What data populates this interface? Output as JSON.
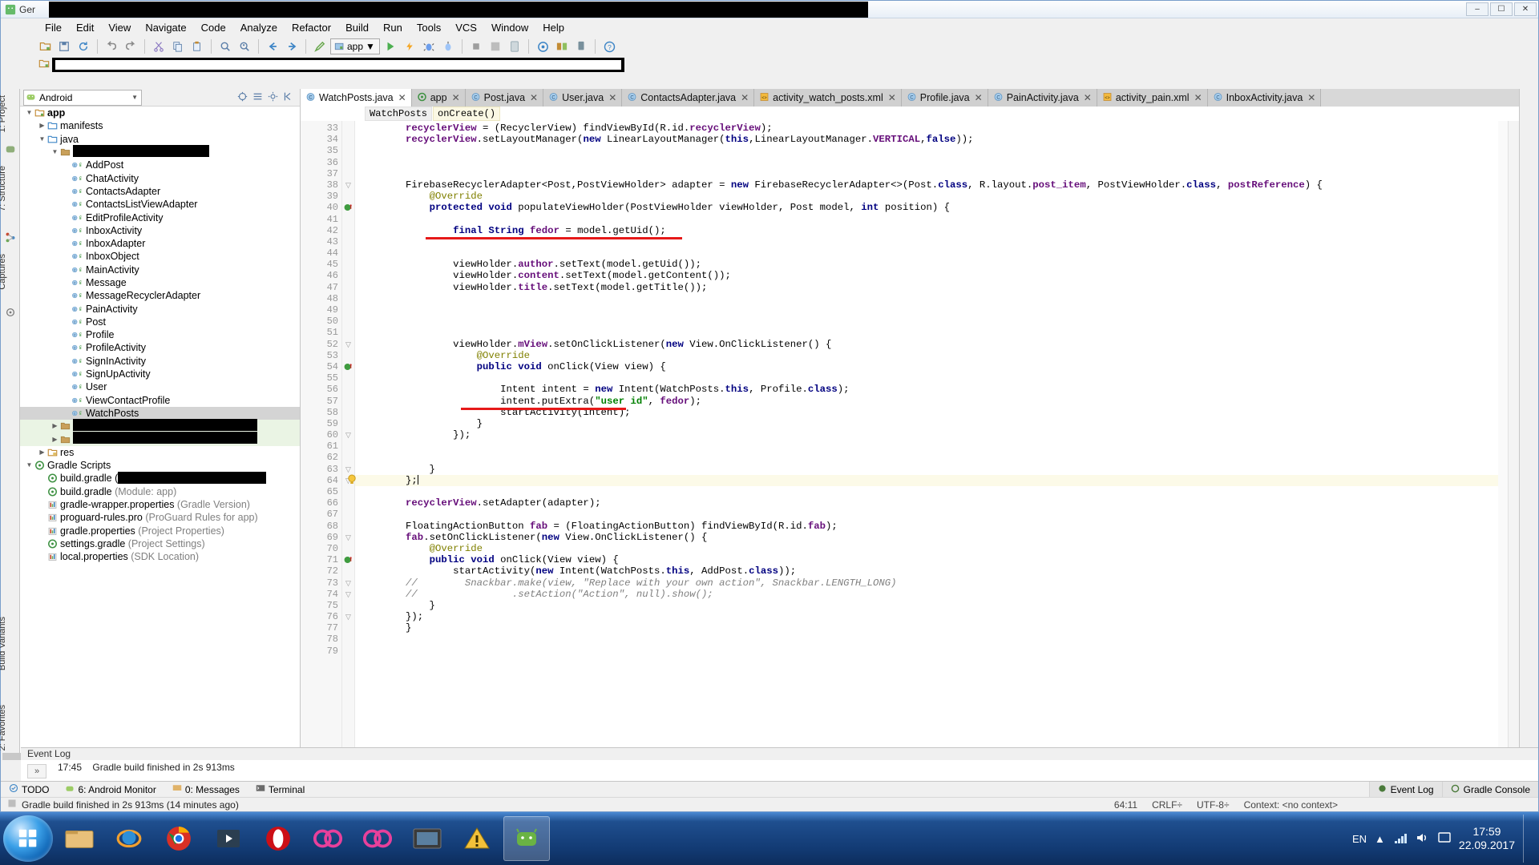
{
  "window": {
    "title": "Ger",
    "minimize": "–",
    "maximize": "☐",
    "close": "✕",
    "redacted": ""
  },
  "menubar": [
    {
      "label": "File"
    },
    {
      "label": "Edit"
    },
    {
      "label": "View"
    },
    {
      "label": "Navigate"
    },
    {
      "label": "Code"
    },
    {
      "label": "Analyze"
    },
    {
      "label": "Refactor"
    },
    {
      "label": "Build"
    },
    {
      "label": "Run"
    },
    {
      "label": "Tools"
    },
    {
      "label": "VCS"
    },
    {
      "label": "Window"
    },
    {
      "label": "Help"
    }
  ],
  "toolbar": {
    "run_config": "app",
    "icons": [
      "open-folder-icon",
      "save-all-icon",
      "sync-icon",
      "undo-icon",
      "redo-icon",
      "cut-icon",
      "copy-icon",
      "paste-icon",
      "find-icon",
      "find-usages-icon",
      "back-icon",
      "forward-icon",
      "build-icon"
    ],
    "right_icons": [
      "run-icon",
      "debug-icon",
      "instant-run-icon",
      "avd-manager-icon",
      "sdk-manager-icon",
      "stop-icon",
      "sync-gradle-icon",
      "project-structure-icon",
      "settings-icon",
      "android-device-monitor-icon",
      "help-icon"
    ]
  },
  "project_panel": {
    "scope": "Android",
    "header_icons": [
      "collapse-all-icon",
      "target-icon",
      "settings-icon",
      "hide-icon"
    ],
    "tree": [
      {
        "indent": 0,
        "arrow": "open",
        "icon": "module-icon",
        "label": "app",
        "bold": true
      },
      {
        "indent": 1,
        "arrow": "closed",
        "icon": "folder-icon",
        "label": "manifests"
      },
      {
        "indent": 1,
        "arrow": "open",
        "icon": "folder-icon",
        "label": "java"
      },
      {
        "indent": 2,
        "arrow": "open",
        "icon": "package-icon",
        "label": "",
        "redacted": true,
        "redact_width": 170
      },
      {
        "indent": 3,
        "arrow": "none",
        "icon": "class-icon",
        "label": "AddPost"
      },
      {
        "indent": 3,
        "arrow": "none",
        "icon": "class-icon",
        "label": "ChatActivity"
      },
      {
        "indent": 3,
        "arrow": "none",
        "icon": "class-icon",
        "label": "ContactsAdapter"
      },
      {
        "indent": 3,
        "arrow": "none",
        "icon": "class-icon",
        "label": "ContactsListViewAdapter"
      },
      {
        "indent": 3,
        "arrow": "none",
        "icon": "class-icon",
        "label": "EditProfileActivity"
      },
      {
        "indent": 3,
        "arrow": "none",
        "icon": "class-icon",
        "label": "InboxActivity"
      },
      {
        "indent": 3,
        "arrow": "none",
        "icon": "class-icon",
        "label": "InboxAdapter"
      },
      {
        "indent": 3,
        "arrow": "none",
        "icon": "class-icon",
        "label": "InboxObject"
      },
      {
        "indent": 3,
        "arrow": "none",
        "icon": "class-icon",
        "label": "MainActivity"
      },
      {
        "indent": 3,
        "arrow": "none",
        "icon": "class-icon",
        "label": "Message"
      },
      {
        "indent": 3,
        "arrow": "none",
        "icon": "class-icon",
        "label": "MessageRecyclerAdapter"
      },
      {
        "indent": 3,
        "arrow": "none",
        "icon": "class-icon",
        "label": "PainActivity"
      },
      {
        "indent": 3,
        "arrow": "none",
        "icon": "class-icon",
        "label": "Post"
      },
      {
        "indent": 3,
        "arrow": "none",
        "icon": "class-icon",
        "label": "Profile"
      },
      {
        "indent": 3,
        "arrow": "none",
        "icon": "class-icon",
        "label": "ProfileActivity"
      },
      {
        "indent": 3,
        "arrow": "none",
        "icon": "class-icon",
        "label": "SignInActivity"
      },
      {
        "indent": 3,
        "arrow": "none",
        "icon": "class-icon",
        "label": "SignUpActivity"
      },
      {
        "indent": 3,
        "arrow": "none",
        "icon": "class-icon",
        "label": "User"
      },
      {
        "indent": 3,
        "arrow": "none",
        "icon": "class-icon",
        "label": "ViewContactProfile"
      },
      {
        "indent": 3,
        "arrow": "none",
        "icon": "class-icon",
        "label": "WatchPosts",
        "selected": true
      },
      {
        "indent": 2,
        "arrow": "closed",
        "icon": "package-icon",
        "label": "",
        "redacted": true,
        "redact_width": 230,
        "green": true
      },
      {
        "indent": 2,
        "arrow": "closed",
        "icon": "package-icon",
        "label": "",
        "redacted": true,
        "redact_width": 230,
        "green": true
      },
      {
        "indent": 1,
        "arrow": "closed",
        "icon": "res-icon",
        "label": "res"
      },
      {
        "indent": 0,
        "arrow": "open",
        "icon": "gradle-icon",
        "label": "Gradle Scripts"
      },
      {
        "indent": 1,
        "arrow": "none",
        "icon": "gradle-file-icon",
        "label": "build.gradle (",
        "redacted_tail": true,
        "redact_width": 185
      },
      {
        "indent": 1,
        "arrow": "none",
        "icon": "gradle-file-icon",
        "label": "build.gradle ",
        "dim": "(Module: app)"
      },
      {
        "indent": 1,
        "arrow": "none",
        "icon": "properties-icon",
        "label": "gradle-wrapper.properties ",
        "dim": "(Gradle Version)"
      },
      {
        "indent": 1,
        "arrow": "none",
        "icon": "properties-icon",
        "label": "proguard-rules.pro ",
        "dim": "(ProGuard Rules for app)"
      },
      {
        "indent": 1,
        "arrow": "none",
        "icon": "properties-icon",
        "label": "gradle.properties ",
        "dim": "(Project Properties)"
      },
      {
        "indent": 1,
        "arrow": "none",
        "icon": "gradle-file-icon",
        "label": "settings.gradle ",
        "dim": "(Project Settings)"
      },
      {
        "indent": 1,
        "arrow": "none",
        "icon": "properties-icon",
        "label": "local.properties ",
        "dim": "(SDK Location)"
      }
    ]
  },
  "left_tool_tabs": [
    "1: Project",
    "7: Structure",
    "Captures"
  ],
  "left_bottom_tabs": [
    "Build Variants",
    "2: Favorites"
  ],
  "editor": {
    "tabs": [
      {
        "label": "WatchPosts.java",
        "icon": "java-class-icon",
        "active": true
      },
      {
        "label": "app",
        "icon": "gradle-icon",
        "active": false
      },
      {
        "label": "Post.java",
        "icon": "java-class-icon",
        "active": false
      },
      {
        "label": "User.java",
        "icon": "java-class-icon",
        "active": false
      },
      {
        "label": "ContactsAdapter.java",
        "icon": "java-class-icon",
        "active": false
      },
      {
        "label": "activity_watch_posts.xml",
        "icon": "xml-layout-icon",
        "active": false
      },
      {
        "label": "Profile.java",
        "icon": "java-class-icon",
        "active": false
      },
      {
        "label": "PainActivity.java",
        "icon": "java-class-icon",
        "active": false
      },
      {
        "label": "activity_pain.xml",
        "icon": "xml-layout-icon",
        "active": false
      },
      {
        "label": "InboxActivity.java",
        "icon": "java-class-icon",
        "active": false
      }
    ],
    "breadcrumbs": [
      "WatchPosts",
      "onCreate()"
    ],
    "first_line_number": 33,
    "lines": [
      {
        "n": 33,
        "indent": 4,
        "html": "recyclerView = (RecyclerView) findViewById(R.id.<span class=\"fld\">recyclerView</span>);",
        "plain": "recyclerView = (RecyclerView) findViewById(R.id.recyclerView);"
      },
      {
        "n": 34,
        "plain": "recyclerView.setLayoutManager(new LinearLayoutManager(this,LinearLayoutManager.VERTICAL,false));"
      },
      {
        "n": 35,
        "plain": ""
      },
      {
        "n": 36,
        "plain": ""
      },
      {
        "n": 37,
        "plain": ""
      },
      {
        "n": 38,
        "plain": "FirebaseRecyclerAdapter<Post,PostViewHolder> adapter = new FirebaseRecyclerAdapter<>(Post.class, R.layout.post_item, PostViewHolder.class, postReference) {"
      },
      {
        "n": 39,
        "plain": "    @Override"
      },
      {
        "n": 40,
        "plain": "    protected void populateViewHolder(PostViewHolder viewHolder, Post model, int position) {"
      },
      {
        "n": 41,
        "plain": ""
      },
      {
        "n": 42,
        "plain": "        final String fedor = model.getUid();"
      },
      {
        "n": 43,
        "plain": ""
      },
      {
        "n": 44,
        "plain": ""
      },
      {
        "n": 45,
        "plain": "        viewHolder.author.setText(model.getUid());"
      },
      {
        "n": 46,
        "plain": "        viewHolder.content.setText(model.getContent());"
      },
      {
        "n": 47,
        "plain": "        viewHolder.title.setText(model.getTitle());"
      },
      {
        "n": 48,
        "plain": ""
      },
      {
        "n": 49,
        "plain": ""
      },
      {
        "n": 50,
        "plain": ""
      },
      {
        "n": 51,
        "plain": ""
      },
      {
        "n": 52,
        "plain": "        viewHolder.mView.setOnClickListener(new View.OnClickListener() {"
      },
      {
        "n": 53,
        "plain": "            @Override"
      },
      {
        "n": 54,
        "plain": "            public void onClick(View view) {"
      },
      {
        "n": 55,
        "plain": ""
      },
      {
        "n": 56,
        "plain": "                Intent intent = new Intent(WatchPosts.this, Profile.class);"
      },
      {
        "n": 57,
        "plain": "                intent.putExtra(\"user id\", fedor);"
      },
      {
        "n": 58,
        "plain": "                startActivity(intent);"
      },
      {
        "n": 59,
        "plain": "            }"
      },
      {
        "n": 60,
        "plain": "        });"
      },
      {
        "n": 61,
        "plain": ""
      },
      {
        "n": 62,
        "plain": ""
      },
      {
        "n": 63,
        "plain": "    }"
      },
      {
        "n": 64,
        "plain": "};",
        "highlight": true
      },
      {
        "n": 65,
        "plain": ""
      },
      {
        "n": 66,
        "plain": "recyclerView.setAdapter(adapter);"
      },
      {
        "n": 67,
        "plain": ""
      },
      {
        "n": 68,
        "plain": "FloatingActionButton fab = (FloatingActionButton) findViewById(R.id.fab);"
      },
      {
        "n": 69,
        "plain": "fab.setOnClickListener(new View.OnClickListener() {"
      },
      {
        "n": 70,
        "plain": "    @Override"
      },
      {
        "n": 71,
        "plain": "    public void onClick(View view) {"
      },
      {
        "n": 72,
        "plain": "        startActivity(new Intent(WatchPosts.this, AddPost.class));"
      },
      {
        "n": 73,
        "plain": "//        Snackbar.make(view, \"Replace with your own action\", Snackbar.LENGTH_LONG)"
      },
      {
        "n": 74,
        "plain": "//                .setAction(\"Action\", null).show();"
      },
      {
        "n": 75,
        "plain": "    }"
      },
      {
        "n": 76,
        "plain": "});"
      },
      {
        "n": 77,
        "plain": "}"
      },
      {
        "n": 78,
        "plain": ""
      },
      {
        "n": 79,
        "plain": ""
      }
    ]
  },
  "event_log": {
    "title": "Event Log",
    "entry_time": "17:45",
    "entry_text": "Gradle build finished in 2s 913ms",
    "collapse": "»"
  },
  "status_tools": {
    "left": [
      {
        "label": "TODO",
        "icon": "todo-icon"
      },
      {
        "label": "6: Android Monitor",
        "icon": "android-icon"
      },
      {
        "label": "0: Messages",
        "icon": "messages-icon"
      },
      {
        "label": "Terminal",
        "icon": "terminal-icon"
      }
    ],
    "right": [
      {
        "label": "Event Log",
        "icon": "event-log-icon"
      },
      {
        "label": "Gradle Console",
        "icon": "gradle-console-icon"
      }
    ]
  },
  "info_bar": {
    "message": "Gradle build finished in 2s 913ms (14 minutes ago)",
    "caret": "64:11",
    "line_separator": "CRLF÷",
    "encoding": "UTF-8÷",
    "context": "Context: <no context>"
  },
  "taskbar": {
    "start": "start-orb",
    "items": [
      {
        "name": "explorer-icon"
      },
      {
        "name": "internet-explorer-icon"
      },
      {
        "name": "chrome-icon"
      },
      {
        "name": "media-player-icon"
      },
      {
        "name": "opera-icon"
      },
      {
        "name": "app-pink-icon"
      },
      {
        "name": "app-pink-2-icon"
      },
      {
        "name": "video-icon"
      },
      {
        "name": "warning-icon"
      },
      {
        "name": "android-studio-icon",
        "active": true
      }
    ],
    "lang": "EN",
    "time": "17:59",
    "date": "22.09.2017",
    "tray_icons": [
      "show-hidden-icon",
      "network-icon",
      "volume-icon",
      "action-center-icon"
    ]
  },
  "colors": {
    "accent_blue": "#3a6ea5",
    "keyword": "#000080",
    "field": "#660e7a",
    "string": "#008000",
    "comment": "#808080",
    "annotation": "#808000",
    "error_red": "#e61919",
    "highlight_line": "#fcfae8",
    "selection_gray": "#d4d4d4"
  }
}
